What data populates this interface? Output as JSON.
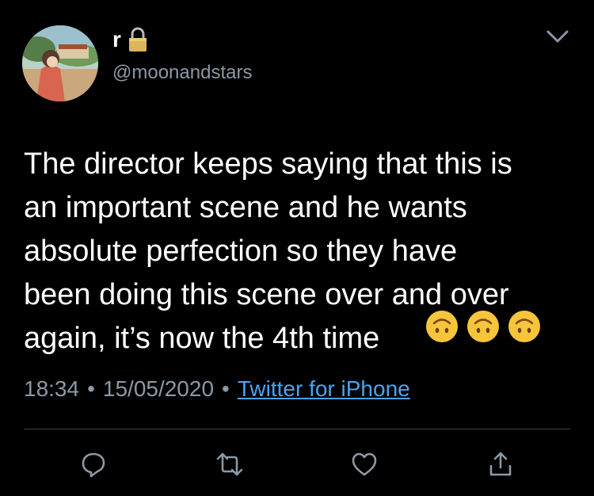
{
  "user": {
    "display_name": "r",
    "handle": "@moonandstars",
    "protected_icon": "lock-icon"
  },
  "header": {
    "menu_icon": "chevron-down-icon"
  },
  "tweet": {
    "text": "The director keeps saying that this is\nan important scene and he wants\nabsolute perfection so they have\nbeen doing this scene over and over\nagain, it’s now the 4th time",
    "emojis": [
      "upside-down-face-emoji",
      "upside-down-face-emoji",
      "upside-down-face-emoji"
    ]
  },
  "meta": {
    "time": "18:34",
    "separator": "•",
    "date": "15/05/2020",
    "source": "Twitter for iPhone"
  },
  "actions": {
    "reply_icon": "reply-icon",
    "retweet_icon": "retweet-icon",
    "like_icon": "heart-icon",
    "share_icon": "share-icon"
  },
  "colors": {
    "background": "#000000",
    "text": "#ffffff",
    "secondary": "#8b98a5",
    "link": "#4aa3ef",
    "divider": "#38444d"
  }
}
